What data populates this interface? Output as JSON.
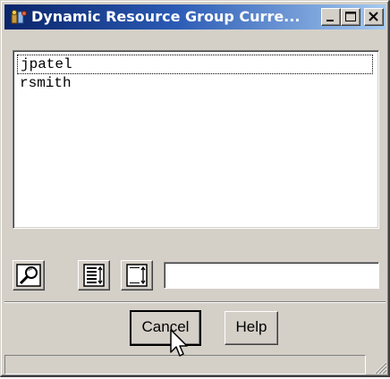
{
  "window": {
    "title": "Dynamic Resource Group Curre...",
    "title_icon": "app-resource-icon",
    "controls": [
      "minimize-icon",
      "maximize-icon",
      "close-icon"
    ]
  },
  "list": {
    "items": [
      "jpatel",
      "rsmith"
    ],
    "focused_index": 0
  },
  "toolbar": {
    "buttons": [
      "magnifier-icon",
      "sort-list-icon",
      "sort-list-alt-icon"
    ],
    "text_value": "",
    "text_placeholder": ""
  },
  "actions": {
    "cancel_label": "Cancel",
    "help_label": "Help"
  },
  "statusbar": {
    "text": ""
  },
  "colors": {
    "titlebar_start": "#0a246a",
    "titlebar_end": "#a6caf0",
    "face": "#d4d0c8"
  }
}
